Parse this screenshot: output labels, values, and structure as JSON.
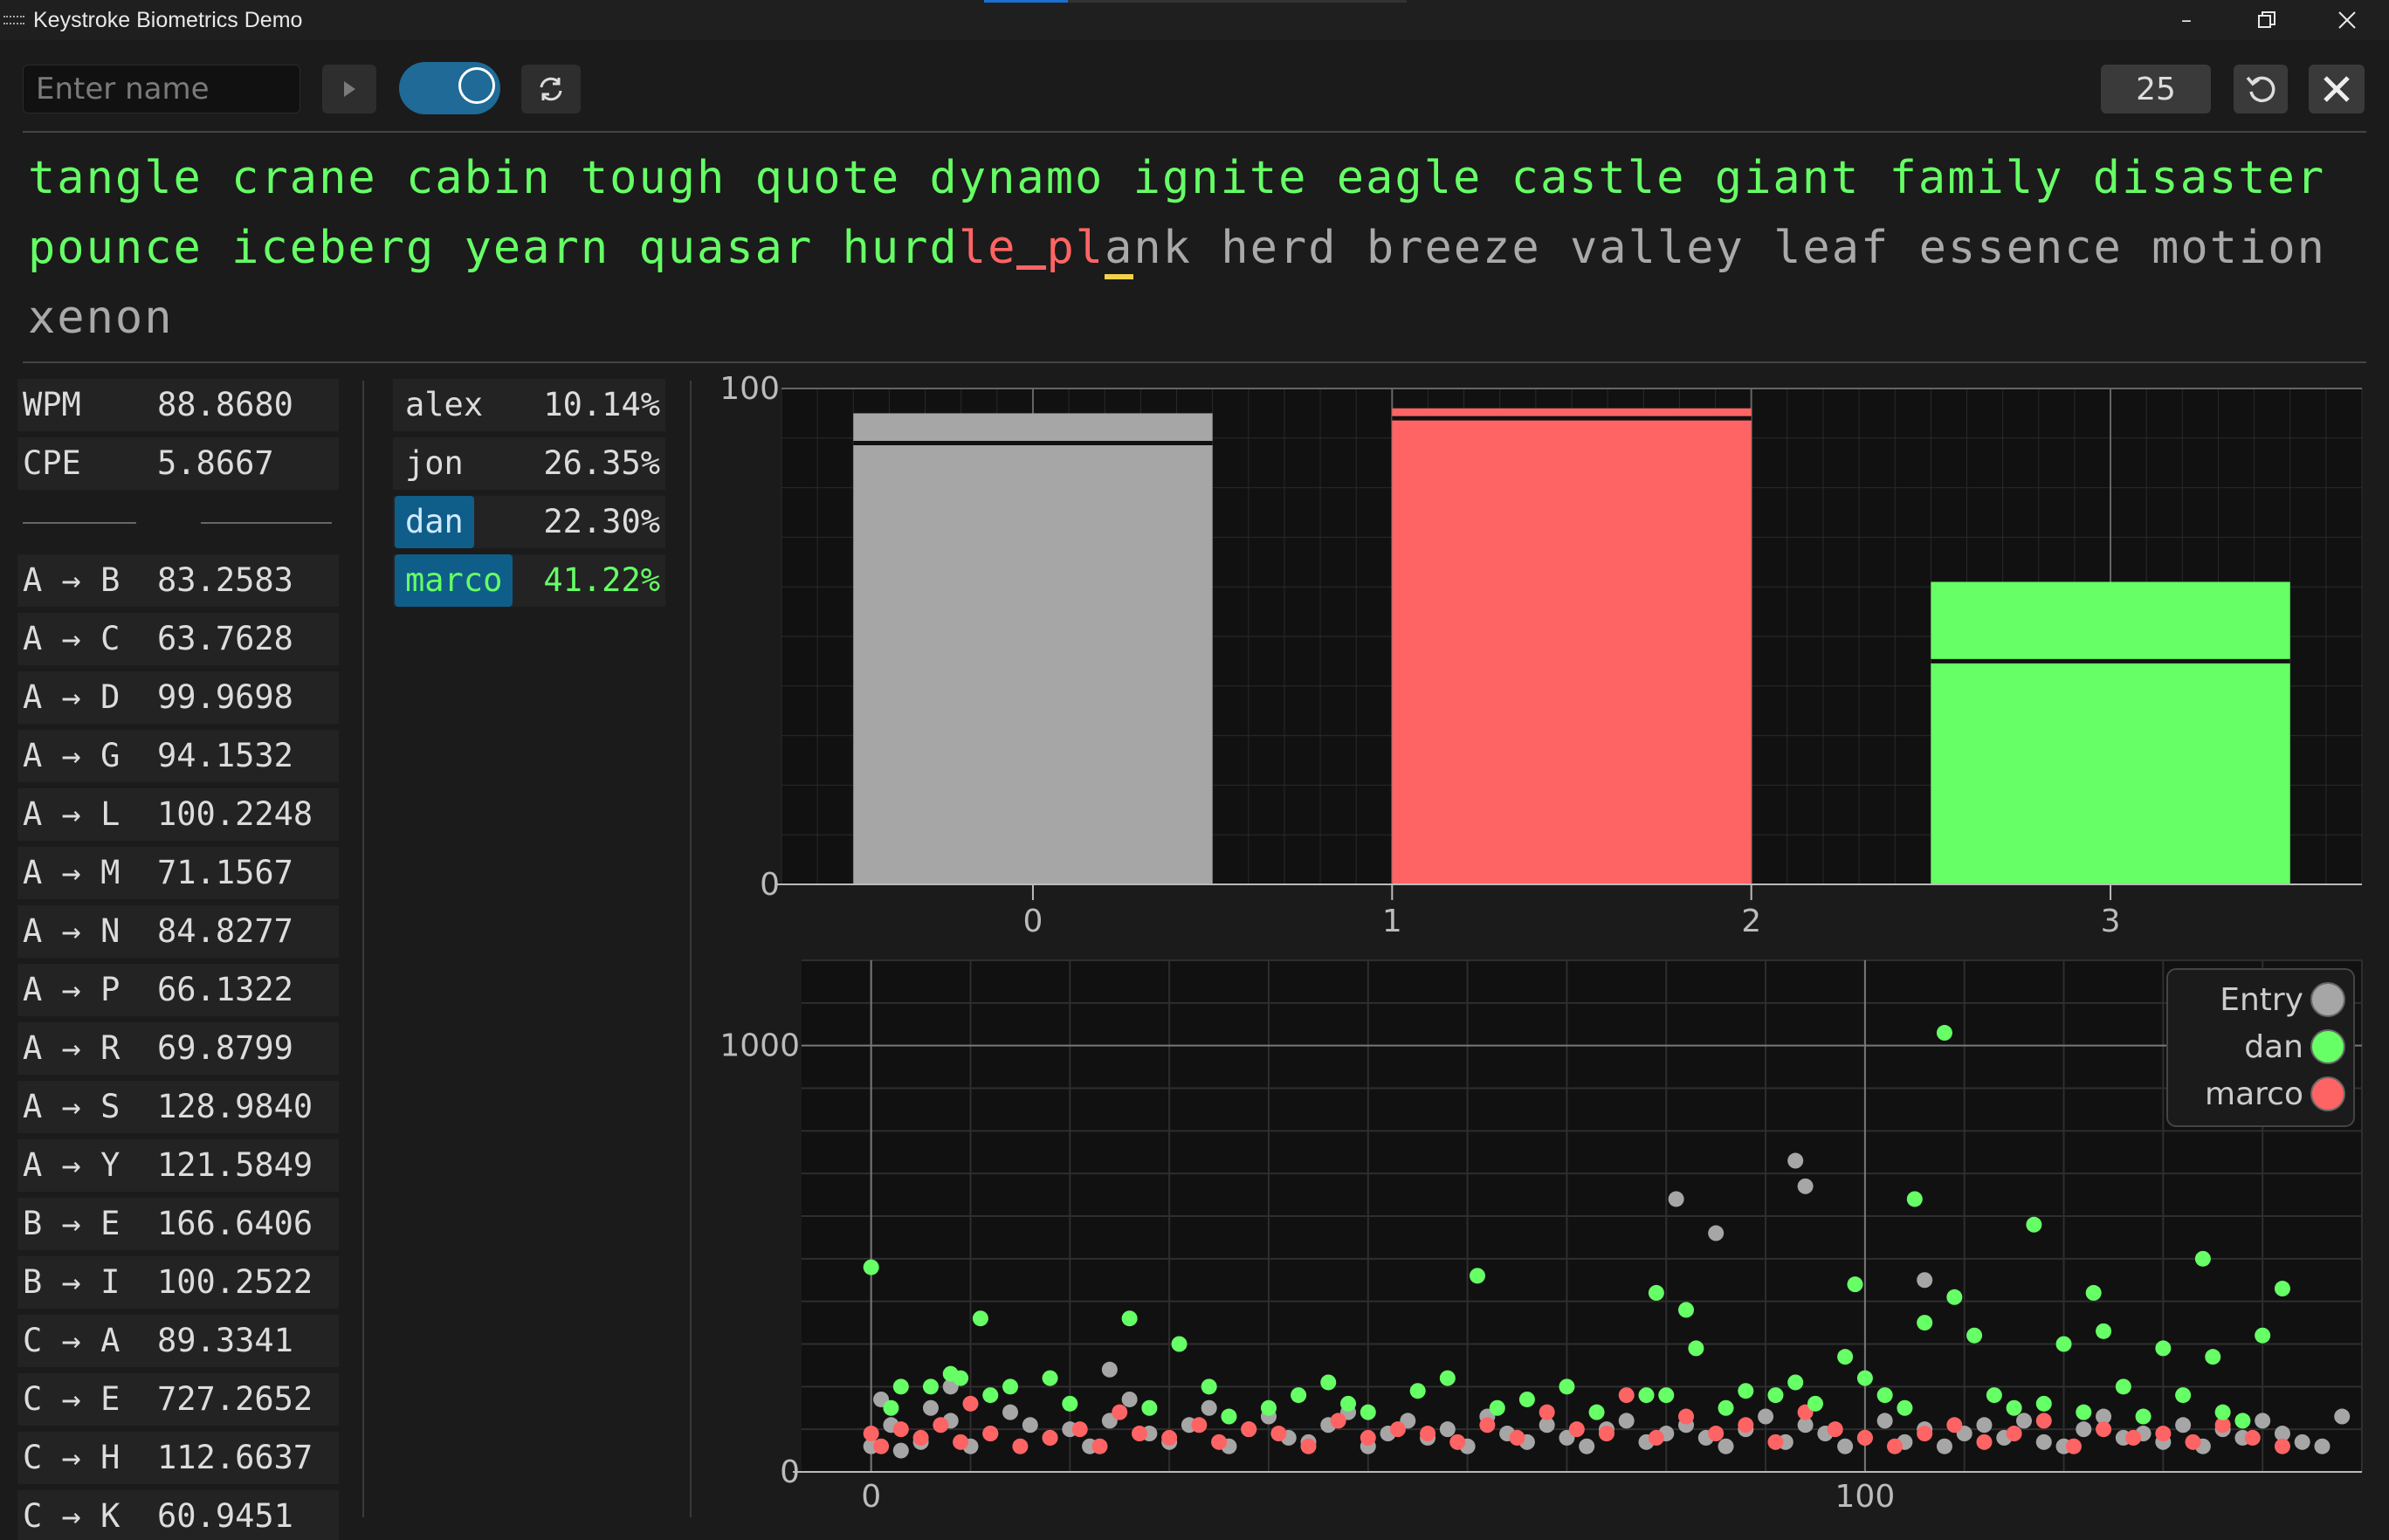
{
  "window": {
    "title": "Keystroke Biometrics Demo"
  },
  "toolbar": {
    "name_placeholder": "Enter name",
    "word_count": "25"
  },
  "typing": {
    "typed_1": "tangle crane cabin tough quote dynamo ignite eagle castle giant family disaster",
    "typed_2": "pounce iceberg yearn quasar hurd",
    "error_1": "le",
    "error_2": "pl",
    "cursor_char": "a",
    "rest_2": "nk herd breeze valley leaf essence motion",
    "line_3": "xenon"
  },
  "stats": [
    {
      "label": "WPM",
      "value": "88.8680"
    },
    {
      "label": "CPE",
      "value": "5.8667"
    }
  ],
  "digraphs": [
    {
      "label": "A → B",
      "value": "83.2583"
    },
    {
      "label": "A → C",
      "value": "63.7628"
    },
    {
      "label": "A → D",
      "value": "99.9698"
    },
    {
      "label": "A → G",
      "value": "94.1532"
    },
    {
      "label": "A → L",
      "value": "100.2248"
    },
    {
      "label": "A → M",
      "value": "71.1567"
    },
    {
      "label": "A → N",
      "value": "84.8277"
    },
    {
      "label": "A → P",
      "value": "66.1322"
    },
    {
      "label": "A → R",
      "value": "69.8799"
    },
    {
      "label": "A → S",
      "value": "128.9840"
    },
    {
      "label": "A → Y",
      "value": "121.5849"
    },
    {
      "label": "B → E",
      "value": "166.6406"
    },
    {
      "label": "B → I",
      "value": "100.2522"
    },
    {
      "label": "C → A",
      "value": "89.3341"
    },
    {
      "label": "C → E",
      "value": "727.2652"
    },
    {
      "label": "C → H",
      "value": "112.6637"
    },
    {
      "label": "C → K",
      "value": "60.9451"
    }
  ],
  "users": [
    {
      "name": "alex",
      "pct": "10.14%",
      "state": "normal"
    },
    {
      "name": "jon",
      "pct": "26.35%",
      "state": "normal"
    },
    {
      "name": "dan",
      "pct": "22.30%",
      "state": "selected"
    },
    {
      "name": "marco",
      "pct": "41.22%",
      "state": "best"
    }
  ],
  "colors": {
    "gray": "#a6a6a6",
    "red": "#ff6464",
    "green": "#66ff66",
    "accent": "#0f5e8a"
  },
  "chart_data": [
    {
      "type": "bar",
      "x_ticks": [
        "0",
        "1",
        "2",
        "3"
      ],
      "y_ticks": [
        "0",
        "100"
      ],
      "ylim": [
        0,
        100
      ],
      "bars": [
        {
          "x0": -0.5,
          "x1": 0.5,
          "value": 95,
          "marker": 89,
          "color": "#a6a6a6"
        },
        {
          "x0": 1,
          "x1": 2,
          "value": 96,
          "marker": 94,
          "color": "#ff6464"
        },
        {
          "x0": 2.5,
          "x1": 3.5,
          "value": 61,
          "marker": 45,
          "color": "#66ff66"
        }
      ],
      "xlim": [
        -0.7,
        3.7
      ],
      "grid": true
    },
    {
      "type": "scatter",
      "x_ticks": [
        "0",
        "100"
      ],
      "y_ticks": [
        "0",
        "1000"
      ],
      "xlim": [
        -7,
        150
      ],
      "ylim": [
        0,
        1200
      ],
      "legend_position": "top-right",
      "series": [
        {
          "name": "Entry",
          "color": "#a6a6a6",
          "points": [
            [
              0,
              60
            ],
            [
              1,
              170
            ],
            [
              2,
              110
            ],
            [
              3,
              50
            ],
            [
              5,
              70
            ],
            [
              6,
              150
            ],
            [
              8,
              120
            ],
            [
              10,
              60
            ],
            [
              12,
              90
            ],
            [
              14,
              140
            ],
            [
              16,
              110
            ],
            [
              18,
              80
            ],
            [
              20,
              100
            ],
            [
              22,
              60
            ],
            [
              24,
              120
            ],
            [
              26,
              170
            ],
            [
              28,
              90
            ],
            [
              30,
              70
            ],
            [
              32,
              110
            ],
            [
              34,
              150
            ],
            [
              36,
              60
            ],
            [
              38,
              100
            ],
            [
              40,
              130
            ],
            [
              42,
              80
            ],
            [
              44,
              70
            ],
            [
              46,
              110
            ],
            [
              48,
              140
            ],
            [
              50,
              60
            ],
            [
              52,
              90
            ],
            [
              54,
              120
            ],
            [
              56,
              80
            ],
            [
              58,
              100
            ],
            [
              60,
              60
            ],
            [
              62,
              130
            ],
            [
              64,
              90
            ],
            [
              66,
              70
            ],
            [
              68,
              110
            ],
            [
              70,
              80
            ],
            [
              72,
              60
            ],
            [
              74,
              100
            ],
            [
              76,
              120
            ],
            [
              78,
              70
            ],
            [
              80,
              90
            ],
            [
              82,
              110
            ],
            [
              84,
              80
            ],
            [
              86,
              60
            ],
            [
              88,
              100
            ],
            [
              90,
              130
            ],
            [
              92,
              70
            ],
            [
              94,
              110
            ],
            [
              96,
              90
            ],
            [
              98,
              60
            ],
            [
              100,
              80
            ],
            [
              102,
              120
            ],
            [
              104,
              70
            ],
            [
              106,
              100
            ],
            [
              108,
              60
            ],
            [
              110,
              90
            ],
            [
              112,
              110
            ],
            [
              114,
              80
            ],
            [
              116,
              120
            ],
            [
              118,
              70
            ],
            [
              120,
              60
            ],
            [
              122,
              100
            ],
            [
              124,
              130
            ],
            [
              126,
              80
            ],
            [
              128,
              90
            ],
            [
              130,
              70
            ],
            [
              132,
              110
            ],
            [
              134,
              60
            ],
            [
              136,
              100
            ],
            [
              138,
              80
            ],
            [
              140,
              120
            ],
            [
              142,
              90
            ],
            [
              144,
              70
            ],
            [
              146,
              60
            ],
            [
              148,
              130
            ],
            [
              8,
              200
            ],
            [
              24,
              240
            ],
            [
              81,
              640
            ],
            [
              85,
              560
            ],
            [
              93,
              730
            ],
            [
              94,
              670
            ],
            [
              106,
              450
            ]
          ]
        },
        {
          "name": "dan",
          "color": "#66ff66",
          "points": [
            [
              0,
              480
            ],
            [
              2,
              150
            ],
            [
              3,
              200
            ],
            [
              6,
              200
            ],
            [
              8,
              230
            ],
            [
              9,
              220
            ],
            [
              11,
              360
            ],
            [
              12,
              180
            ],
            [
              14,
              200
            ],
            [
              18,
              220
            ],
            [
              20,
              160
            ],
            [
              26,
              360
            ],
            [
              28,
              150
            ],
            [
              31,
              300
            ],
            [
              34,
              200
            ],
            [
              36,
              130
            ],
            [
              40,
              150
            ],
            [
              43,
              180
            ],
            [
              46,
              210
            ],
            [
              48,
              160
            ],
            [
              50,
              140
            ],
            [
              55,
              190
            ],
            [
              58,
              220
            ],
            [
              61,
              460
            ],
            [
              63,
              150
            ],
            [
              66,
              170
            ],
            [
              70,
              200
            ],
            [
              73,
              140
            ],
            [
              78,
              180
            ],
            [
              79,
              420
            ],
            [
              80,
              180
            ],
            [
              82,
              380
            ],
            [
              83,
              290
            ],
            [
              86,
              150
            ],
            [
              88,
              190
            ],
            [
              91,
              180
            ],
            [
              93,
              210
            ],
            [
              95,
              160
            ],
            [
              98,
              270
            ],
            [
              99,
              440
            ],
            [
              100,
              220
            ],
            [
              102,
              180
            ],
            [
              104,
              150
            ],
            [
              105,
              640
            ],
            [
              106,
              350
            ],
            [
              108,
              1030
            ],
            [
              109,
              410
            ],
            [
              111,
              320
            ],
            [
              113,
              180
            ],
            [
              115,
              150
            ],
            [
              117,
              580
            ],
            [
              118,
              160
            ],
            [
              120,
              300
            ],
            [
              122,
              140
            ],
            [
              123,
              420
            ],
            [
              124,
              330
            ],
            [
              126,
              200
            ],
            [
              128,
              130
            ],
            [
              130,
              290
            ],
            [
              132,
              180
            ],
            [
              134,
              500
            ],
            [
              135,
              270
            ],
            [
              136,
              140
            ],
            [
              138,
              120
            ],
            [
              140,
              320
            ],
            [
              142,
              430
            ]
          ]
        },
        {
          "name": "marco",
          "color": "#ff6464",
          "points": [
            [
              0,
              90
            ],
            [
              1,
              60
            ],
            [
              3,
              100
            ],
            [
              5,
              80
            ],
            [
              7,
              110
            ],
            [
              9,
              70
            ],
            [
              10,
              160
            ],
            [
              12,
              90
            ],
            [
              15,
              60
            ],
            [
              18,
              80
            ],
            [
              21,
              100
            ],
            [
              23,
              60
            ],
            [
              25,
              140
            ],
            [
              27,
              90
            ],
            [
              30,
              80
            ],
            [
              33,
              110
            ],
            [
              35,
              70
            ],
            [
              38,
              100
            ],
            [
              41,
              90
            ],
            [
              44,
              60
            ],
            [
              47,
              120
            ],
            [
              50,
              80
            ],
            [
              53,
              100
            ],
            [
              56,
              90
            ],
            [
              59,
              70
            ],
            [
              62,
              110
            ],
            [
              65,
              80
            ],
            [
              68,
              140
            ],
            [
              71,
              100
            ],
            [
              74,
              90
            ],
            [
              76,
              180
            ],
            [
              79,
              80
            ],
            [
              82,
              130
            ],
            [
              85,
              90
            ],
            [
              88,
              110
            ],
            [
              91,
              70
            ],
            [
              94,
              140
            ],
            [
              97,
              100
            ],
            [
              100,
              80
            ],
            [
              103,
              60
            ],
            [
              106,
              90
            ],
            [
              109,
              110
            ],
            [
              112,
              70
            ],
            [
              115,
              90
            ],
            [
              118,
              120
            ],
            [
              121,
              60
            ],
            [
              124,
              100
            ],
            [
              127,
              80
            ],
            [
              130,
              90
            ],
            [
              133,
              70
            ],
            [
              136,
              110
            ],
            [
              139,
              80
            ],
            [
              142,
              60
            ]
          ]
        }
      ]
    }
  ]
}
